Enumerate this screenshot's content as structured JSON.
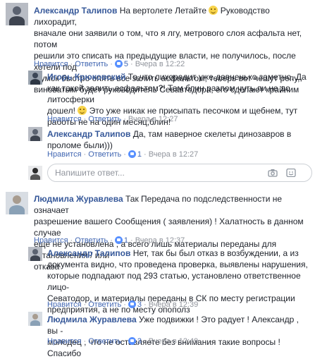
{
  "comments": [
    {
      "author": "Александр Талипов",
      "lines": [
        "На вертолете Летайте",
        "вначале они заявили о том, что я лгу, метрового слоя асфальта нет, потом",
        "решили это списать на предыдущие власти, не получилось, после хотели под",
        "шумок быстро опять все залить асфальтом, теперь вот чешут репу,",
        "виноватым будет руководитель Севавтодора, его сделают крайним"
      ],
      "line1_tail": "Руководство лихорадит,",
      "like": "Нравится",
      "reply": "Ответить",
      "likes": "5",
      "time": "Вчера в 12:22"
    },
    {
      "author": "Игорь Крюковский",
      "lines": [
        "То,что лихорадит уже давненько заметно. Да",
        "как такой залить асфальтом?! Там блин разлом чуть ли не до литосферки",
        "дошел!",
        "Это уже никак не присыпать песочком и щебнем, тут",
        "работы не на один месяц,блин!"
      ],
      "like": "Нравится",
      "reply": "Ответить",
      "time": "Вчера в 12:27"
    },
    {
      "author": "Александр Талипов",
      "lines": [
        "Да, там наверное скелеты динозавров в",
        "проломе были)))"
      ],
      "like": "Нравится",
      "reply": "Ответить",
      "likes": "1",
      "time": "Вчера в 12:27"
    },
    {
      "author": "Людмила Журавлева",
      "lines": [
        "Так Передача по подследственности не означает",
        "разрешение вашего Сообщения ( заявления) ! Халатность в данном случае",
        "ещё не установлена , а всего лишь материалы переданы для установления / или",
        "отказа"
      ],
      "like": "Нравится",
      "reply": "Ответить",
      "likes": "1",
      "time": "Вчера в 12:37"
    },
    {
      "author": "Александр Талипов",
      "lines": [
        "Нет, так бы был отказ в возбуждении, а из",
        "документа видно, что проведена проверка, выявлены нарушения,",
        "которые подпадают под 293 статью, установлено ответственное лицо-",
        "Севатодор, и материалы переданы в СК по месту регистрации",
        "предприятия, а не по месту опополз"
      ],
      "like": "Нравится",
      "reply": "Ответить",
      "likes": "3",
      "time": "Вчера в 12:39"
    },
    {
      "author": "Людмила Журавлева",
      "lines": [
        "Уже подвижки ! Это радует ! Александр , вы -",
        "молодец , что не оставляете без внимания такие вопросы ! Спасибо"
      ],
      "like": "Нравится",
      "reply": "Ответить",
      "likes": "3",
      "time": "Вчера в 12:49"
    }
  ],
  "reply_box": {
    "placeholder": "Напишите ответ..."
  }
}
